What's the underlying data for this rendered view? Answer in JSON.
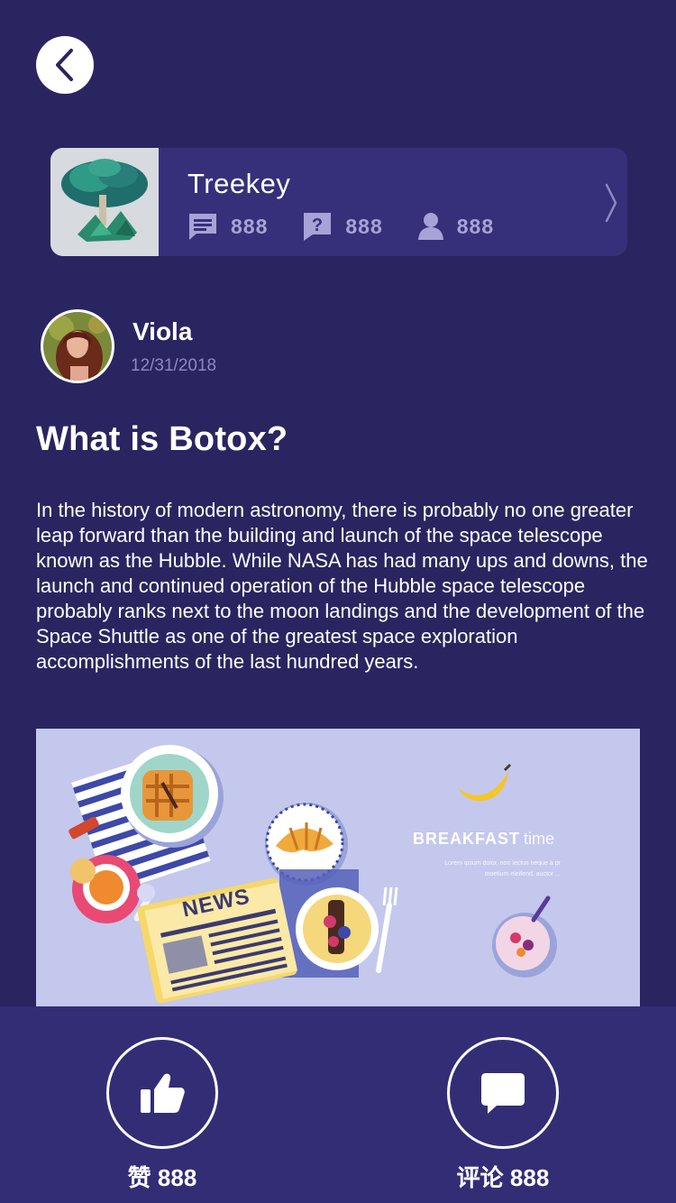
{
  "community": {
    "name": "Treekey",
    "stats": [
      {
        "icon": "message-icon",
        "value": "888"
      },
      {
        "icon": "question-icon",
        "value": "888"
      },
      {
        "icon": "user-icon",
        "value": "888"
      }
    ]
  },
  "post": {
    "author": "Viola",
    "date": "12/31/2018",
    "title": "What is Botox?",
    "body": "In the history of modern astronomy, there is probably no one greater leap forward than the building and launch of the space telescope known as the Hubble. While NASA has had many ups and downs, the launch and continued operation of the Hubble space telescope probably ranks next to the moon landings and the development of the Space Shuttle as one of the greatest space exploration accomplishments of the last hundred years.",
    "image": {
      "headline": "BREAKFAST",
      "headline_light": "time",
      "caption": "Lorem ipsum dolor, non lectus neque a pr moetium eleifend, auctor ...",
      "newspaper": "NEWS"
    }
  },
  "actions": {
    "like_label": "赞",
    "like_count": "888",
    "comment_label": "评论",
    "comment_count": "888"
  },
  "colors": {
    "background": "#2a2560",
    "card": "#36307a",
    "bottom_bar": "#332d76",
    "muted_text": "#a7a3d6"
  }
}
